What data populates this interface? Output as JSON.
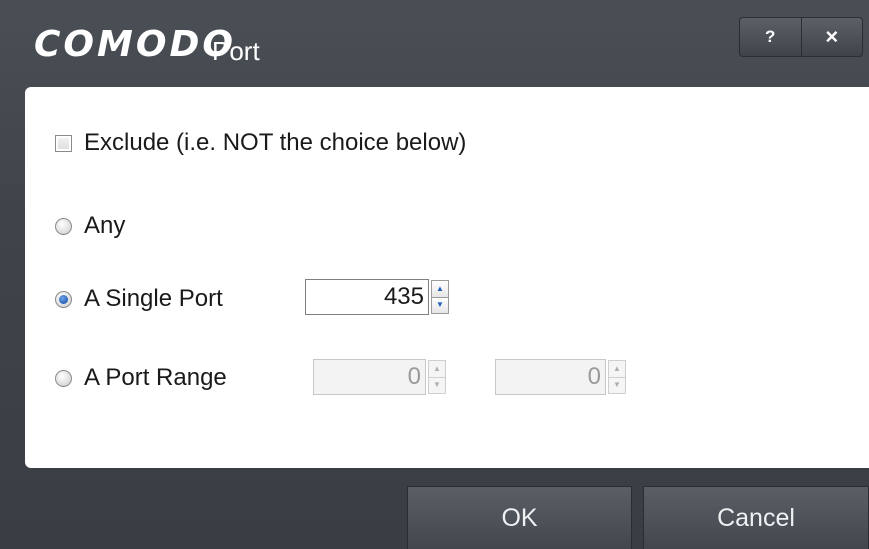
{
  "window": {
    "brand": "COMODO",
    "title": "Port",
    "help_label": "?",
    "close_label": "×"
  },
  "options": {
    "exclude_label": "Exclude (i.e. NOT the choice below)",
    "exclude_checked": false,
    "any_label": "Any",
    "single_port_label": "A Single Port",
    "port_range_label": "A Port Range",
    "selected": "single_port"
  },
  "single_port": {
    "value": "435"
  },
  "port_range": {
    "from": "0",
    "to": "0",
    "separator": "-"
  },
  "spinner": {
    "up_glyph": "▲",
    "down_glyph": "▼"
  },
  "buttons": {
    "ok": "OK",
    "cancel": "Cancel"
  },
  "colors": {
    "frame": "#3f444a",
    "content_bg": "#ffffff",
    "radio_selected": "#1f55b3"
  }
}
